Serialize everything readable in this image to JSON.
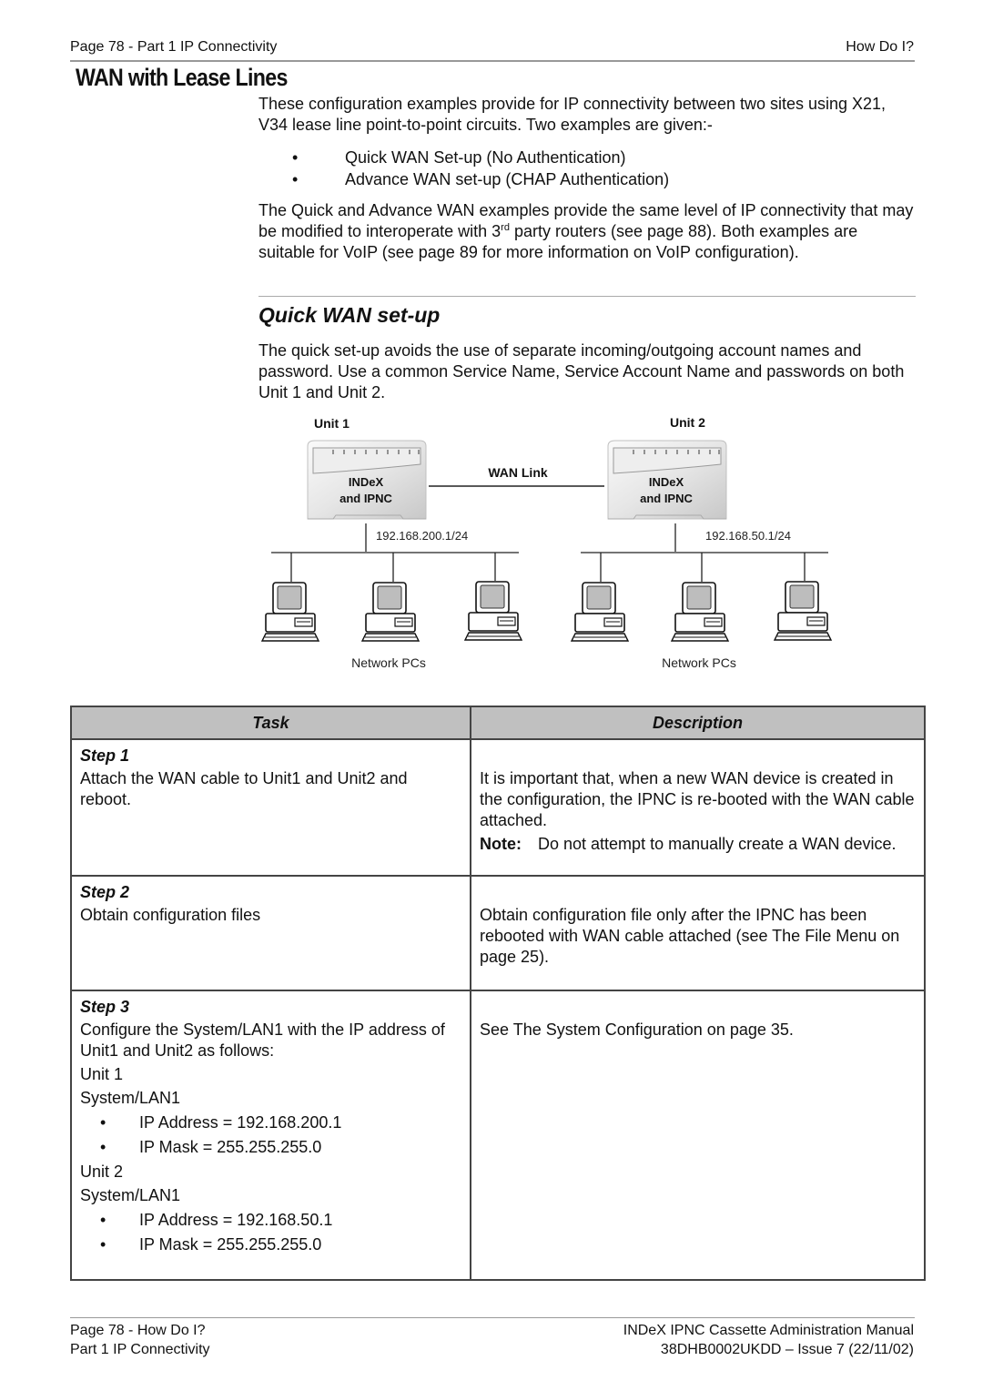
{
  "header": {
    "left": "Page 78 - Part 1 IP Connectivity",
    "right": "How Do I?"
  },
  "title": "WAN with Lease Lines",
  "intro": {
    "paragraph1": "These configuration examples provide for IP connectivity between two sites using X21, V34 lease line point-to-point circuits. Two examples are given:-",
    "bullets": [
      "Quick WAN Set-up (No Authentication)",
      "Advance WAN set-up (CHAP Authentication)"
    ],
    "paragraph2_before_sup": "The Quick and Advance WAN examples provide the same level of IP connectivity that may be modified to interoperate with 3",
    "paragraph2_sup": "rd",
    "paragraph2_after_sup": " party routers (see page 88). Both examples are suitable for VoIP (see page 89 for more information on VoIP configuration)."
  },
  "section": {
    "heading": "Quick WAN set-up",
    "paragraph": "The quick set-up avoids the use of separate incoming/outgoing account names and password. Use a common Service Name, Service Account Name and passwords on both Unit 1 and Unit 2."
  },
  "diagram": {
    "unit1": {
      "label": "Unit 1",
      "device_line1": "INDeX",
      "device_line2": "and IPNC",
      "ip": "192.168.200.1/24"
    },
    "unit2": {
      "label": "Unit 2",
      "device_line1": "INDeX",
      "device_line2": "and IPNC",
      "ip": "192.168.50.1/24"
    },
    "link_label": "WAN Link",
    "left_group_label": "Network PCs",
    "right_group_label": "Network PCs",
    "device_icon": "router-icon",
    "pc_icon": "desktop-computer-icon"
  },
  "table": {
    "headers": [
      "Task",
      "Description"
    ],
    "rows": [
      {
        "step": "Step 1",
        "task": "Attach the WAN cable to Unit1 and Unit2 and reboot.",
        "description": "It is important that, when a new WAN device is created in the configuration, the IPNC is re-booted with the WAN cable attached.",
        "note_label": "Note:",
        "note_text": "Do not attempt to manually create a WAN device."
      },
      {
        "step": "Step 2",
        "task": "Obtain configuration files",
        "description": "Obtain configuration file only after the IPNC has been rebooted with WAN cable attached (see The File Menu on page 25)."
      },
      {
        "step": "Step 3",
        "task": "Configure the System/LAN1 with the IP address of Unit1 and Unit2 as follows:",
        "unit1_label": "Unit 1",
        "unit1_sub": "System/LAN1",
        "unit1_items": [
          "IP Address = 192.168.200.1",
          "IP Mask = 255.255.255.0"
        ],
        "unit2_label": "Unit 2",
        "unit2_sub": "System/LAN1",
        "unit2_items": [
          "IP Address = 192.168.50.1",
          "IP Mask = 255.255.255.0"
        ],
        "description": "See The System Configuration on page 35."
      }
    ]
  },
  "footer": {
    "left_line1": "Page 78 - How Do I?",
    "left_line2": "Part 1 IP Connectivity",
    "right_line1": "INDeX IPNC Cassette Administration Manual",
    "right_line2": "38DHB0002UKDD – Issue 7 (22/11/02)"
  }
}
